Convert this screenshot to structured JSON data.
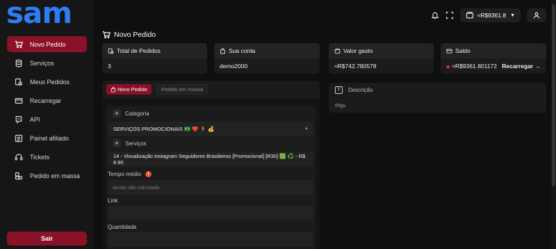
{
  "app": {
    "logo": "sam"
  },
  "sidebar": {
    "items": [
      {
        "label": "Novo Pedido",
        "icon": "cart-icon",
        "active": true
      },
      {
        "label": "Serviços",
        "icon": "database-icon",
        "active": false
      },
      {
        "label": "Meus Pedidos",
        "icon": "orders-icon",
        "active": false
      },
      {
        "label": "Recarregar",
        "icon": "card-icon",
        "active": false
      },
      {
        "label": "API",
        "icon": "api-icon",
        "active": false
      },
      {
        "label": "Painel afiliado",
        "icon": "list-icon",
        "active": false
      },
      {
        "label": "Tickets",
        "icon": "headset-icon",
        "active": false
      },
      {
        "label": "Pedido em massa",
        "icon": "boxes-icon",
        "active": false
      }
    ],
    "logout_label": "Sair"
  },
  "topbar": {
    "balance": "≈R$9361.8"
  },
  "page": {
    "title": "Novo Pedido"
  },
  "stats": {
    "total_orders": {
      "label": "Total de Pedidos",
      "value": "3"
    },
    "account": {
      "label": "Sua conta",
      "value": "demo2000"
    },
    "spent": {
      "label": "Valor gasto",
      "value": "≈R$742.780578"
    },
    "balance": {
      "label": "Saldo",
      "value": "≈R$9361.801172",
      "action": "Recarregar →"
    }
  },
  "order_form": {
    "tabs": {
      "new": "Novo Pedido",
      "mass": "Pedido em massa"
    },
    "category_label": "Categoria",
    "category_value": "SERVIÇOS PROMOCIONAIS 🇧🇷 ❤️ 🏃 💰",
    "services_label": "Serviços",
    "service_value": "14 - Visualização instagram Seguidores Brasileiros [Promocional] [R30] 🟩 ♻️ - R$ 8.90",
    "avg_time_label": "Tempo médio",
    "avg_time_placeholder": "Ainda não calculado",
    "link_label": "Link",
    "quantity_label": "Quantidade"
  },
  "description": {
    "label": "Descrição",
    "value": "Rfgv"
  },
  "colors": {
    "accent": "#8a1228",
    "logo": "#2e7cf6",
    "background": "#0f0f0f",
    "card": "#1b1b1b"
  }
}
